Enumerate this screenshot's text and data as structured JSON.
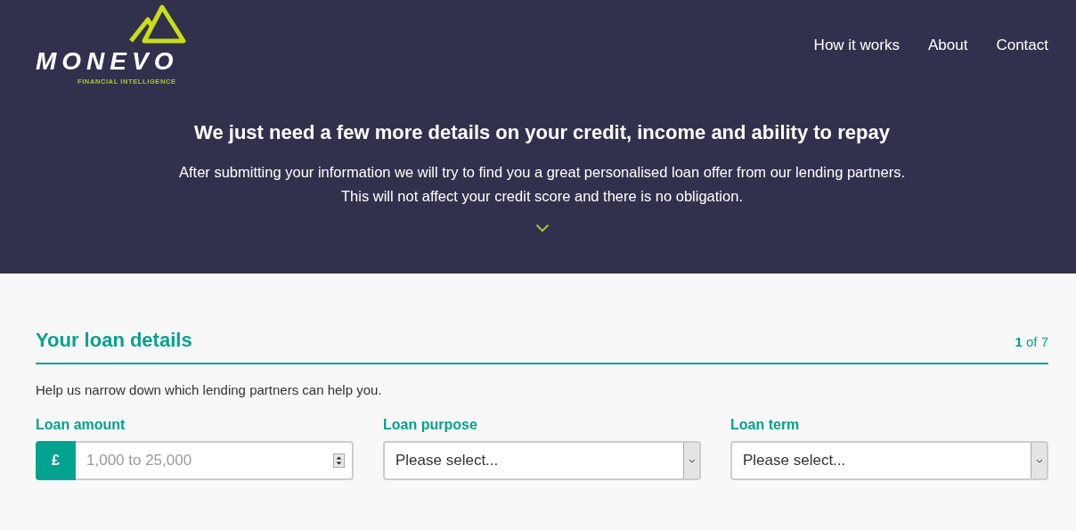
{
  "header": {
    "logo": {
      "wordmark": "MONEVO",
      "tagline": "FINANCIAL INTELLIGENCE"
    },
    "nav": [
      "How it works",
      "About",
      "Contact"
    ],
    "headline": "We just need a few more details on your credit, income and ability to repay",
    "intro": [
      "After submitting your information we will try to find you a great personalised loan offer from our lending partners.",
      "This will not affect your credit score and there is no obligation."
    ]
  },
  "section": {
    "title": "Your loan details",
    "step": "**1** of 7",
    "help": "Help us narrow down which lending partners can help you.",
    "fields": [
      {
        "kind": "number",
        "label": "Loan amount",
        "prefix": "£",
        "placeholder": "1,000 to 25,000"
      },
      {
        "kind": "select",
        "label": "Loan purpose",
        "value": "Please select..."
      },
      {
        "kind": "select",
        "label": "Loan term",
        "value": "Please select..."
      }
    ]
  }
}
